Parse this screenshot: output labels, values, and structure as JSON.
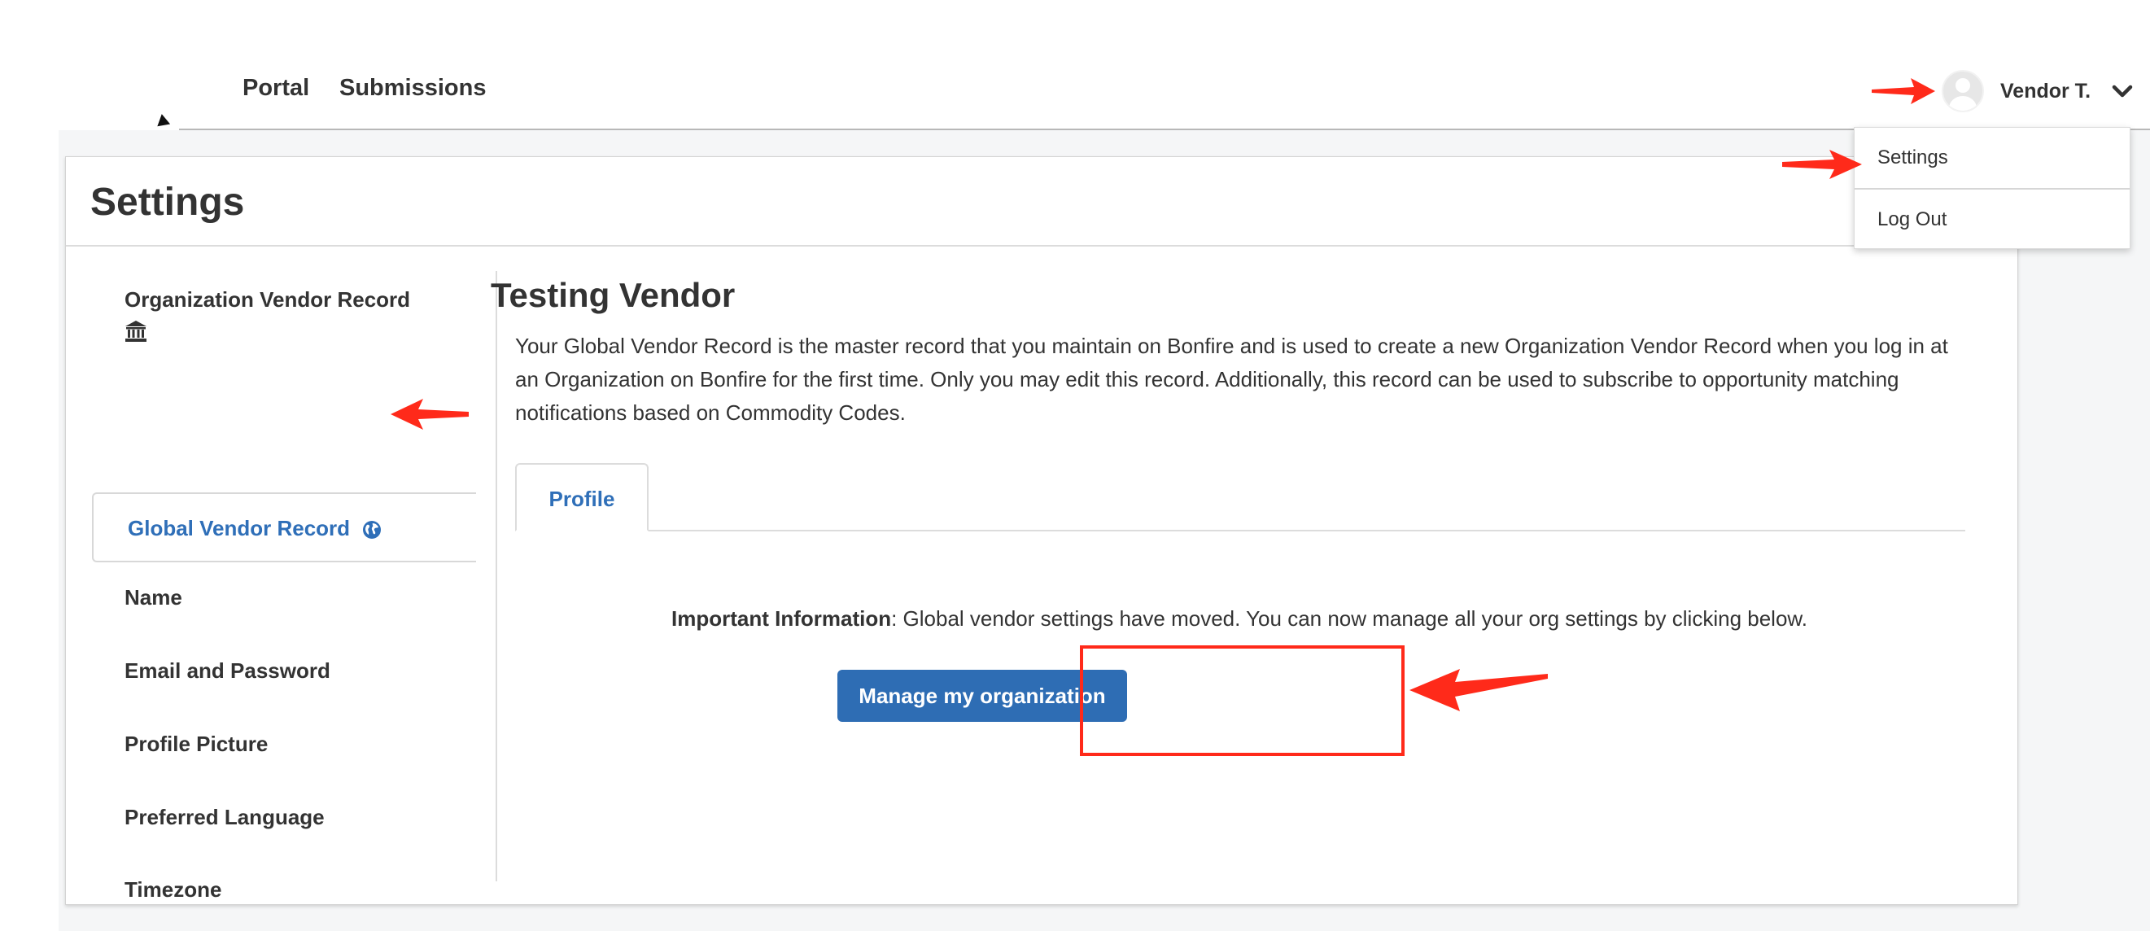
{
  "nav": {
    "portal": "Portal",
    "submissions": "Submissions"
  },
  "user": {
    "name": "Vendor T.",
    "menu": [
      {
        "label": "Settings"
      },
      {
        "label": "Log Out"
      }
    ]
  },
  "page": {
    "title": "Settings"
  },
  "sidebar": {
    "items": [
      {
        "label": "Organization Vendor Record",
        "icon": "bank-icon"
      },
      {
        "label": "Global Vendor Record",
        "icon": "globe-icon",
        "active": true
      },
      {
        "label": "Name"
      },
      {
        "label": "Email and Password"
      },
      {
        "label": "Profile Picture"
      },
      {
        "label": "Preferred Language"
      },
      {
        "label": "Timezone"
      }
    ]
  },
  "content": {
    "title": "Testing Vendor",
    "description": "Your Global Vendor Record is the master record that you maintain on Bonfire and is used to create a new Organization Vendor Record when you log in at an Organization on Bonfire for the first time. Only you may edit this record. Additionally, this record can be used to subscribe to opportunity matching notifications based on Commodity Codes.",
    "tabs": [
      {
        "label": "Profile"
      }
    ],
    "notice_bold": "Important Information",
    "notice_text": ": Global vendor settings have moved. You can now manage all your org settings by clicking below.",
    "button_label": "Manage my organization"
  },
  "colors": {
    "accent": "#2e6db4",
    "link": "#2f6fb8",
    "annotation": "#ff2a1a"
  }
}
